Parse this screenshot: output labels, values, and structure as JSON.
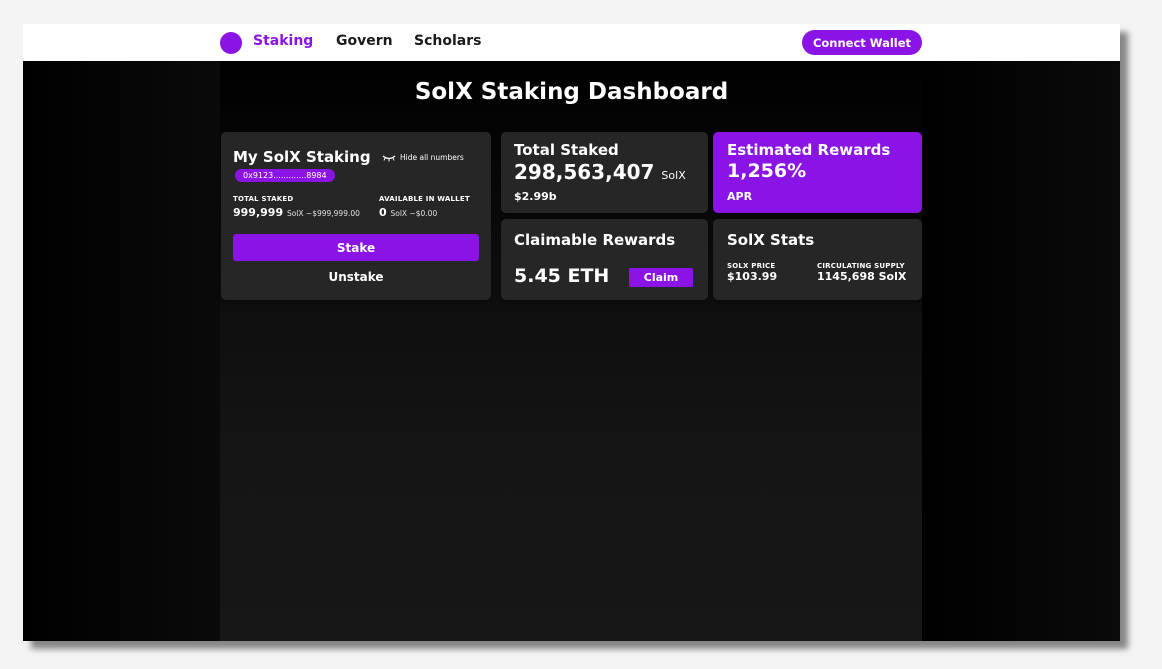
{
  "nav": {
    "items": [
      {
        "label": "Staking",
        "active": true
      },
      {
        "label": "Govern"
      },
      {
        "label": "Scholars"
      }
    ],
    "connect_label": "Connect Wallet"
  },
  "page": {
    "title": "SolX Staking Dashboard"
  },
  "my_staking": {
    "title": "My SolX Staking",
    "hide_label": "Hide all numbers",
    "hide_icon": "eye-closed-icon",
    "address": "0x9123.............8984",
    "total_staked_label": "TOTAL STAKED",
    "total_staked_value": "999,999",
    "total_staked_unit": "SolX ~$999,999.00",
    "wallet_label": "AVAILABLE IN WALLET",
    "wallet_value": "0",
    "wallet_unit": "SolX ~$0.00",
    "stake_label": "Stake",
    "unstake_label": "Unstake"
  },
  "total_staked": {
    "title": "Total Staked",
    "value": "298,563,407",
    "unit": "SolX",
    "usd": "$2.99b"
  },
  "estimated_rewards": {
    "title": "Estimated Rewards",
    "value": "1,256%",
    "sub": "APR"
  },
  "claimable": {
    "title": "Claimable Rewards",
    "value": "5.45 ETH",
    "claim_label": "Claim"
  },
  "stats": {
    "title": "SolX Stats",
    "price_label": "SOLX PRICE",
    "price_value": "$103.99",
    "supply_label": "CIRCULATING SUPPLY",
    "supply_value": "1145,698 SolX"
  },
  "colors": {
    "accent": "#8a14e6",
    "card": "#262626",
    "background": "#141414"
  }
}
